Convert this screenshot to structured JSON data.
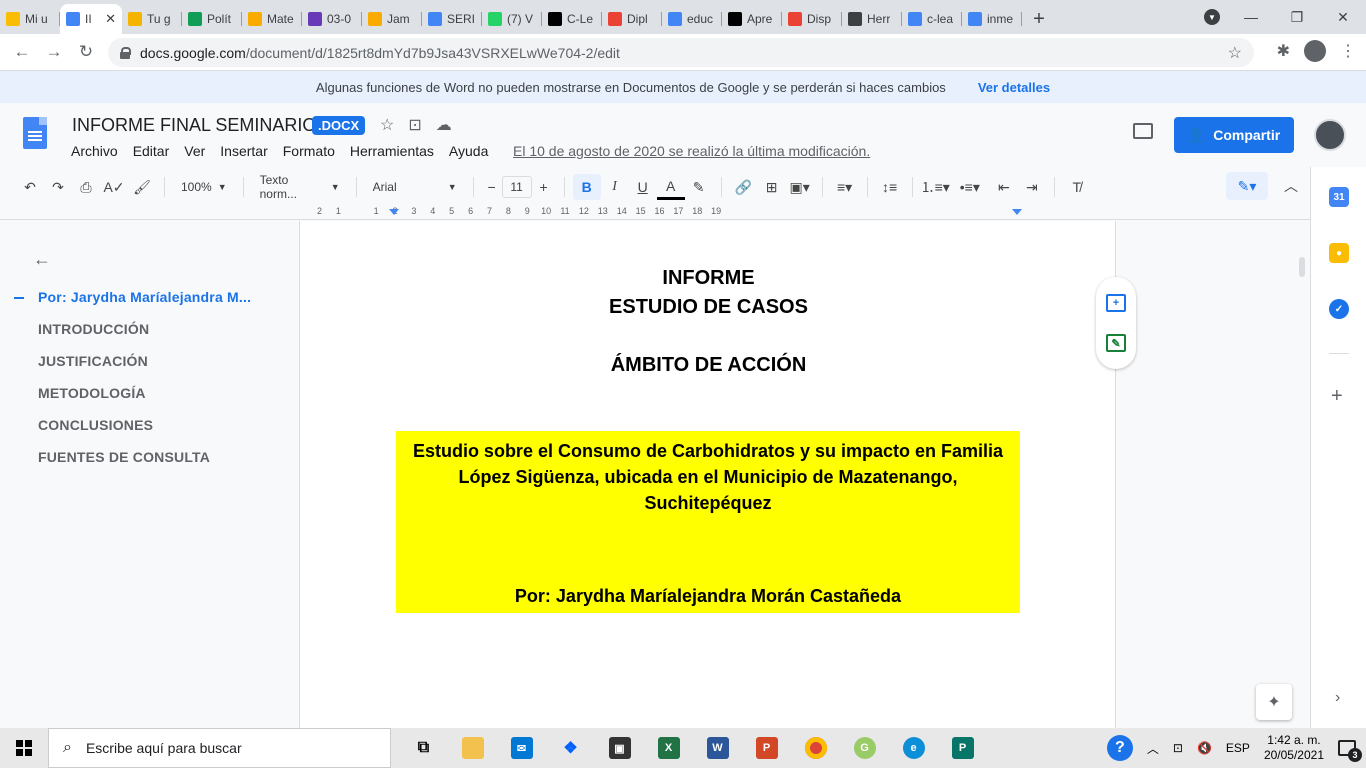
{
  "browser": {
    "tabs": [
      {
        "label": "Mi u",
        "icon": "google-drive-icon",
        "color": "#fbbc04"
      },
      {
        "label": "II",
        "icon": "google-docs-icon",
        "color": "#4285f4",
        "active": true
      },
      {
        "label": "Tu g",
        "icon": "google-slides-icon",
        "color": "#f4b400"
      },
      {
        "label": "Polít",
        "icon": "google-sheets-icon",
        "color": "#0f9d58"
      },
      {
        "label": "Mate",
        "icon": "hand-icon",
        "color": "#f9ab00"
      },
      {
        "label": "03-0",
        "icon": "forms-icon",
        "color": "#673ab7"
      },
      {
        "label": "Jam",
        "icon": "hand-icon",
        "color": "#f9ab00"
      },
      {
        "label": "SERI",
        "icon": "google-docs-icon",
        "color": "#4285f4"
      },
      {
        "label": "(7) V",
        "icon": "whatsapp-icon",
        "color": "#25d366"
      },
      {
        "label": "C-Le",
        "icon": "wix-icon",
        "color": "#000000"
      },
      {
        "label": "Dipl",
        "icon": "gmail-icon",
        "color": "#ea4335"
      },
      {
        "label": "educ",
        "icon": "google-icon",
        "color": "#4285f4"
      },
      {
        "label": "Apre",
        "icon": "wikipedia-icon",
        "color": "#000000"
      },
      {
        "label": "Disp",
        "icon": "colorful-square-icon",
        "color": "#ea4335"
      },
      {
        "label": "Herr",
        "icon": "globe-icon",
        "color": "#3c4043"
      },
      {
        "label": "c-lea",
        "icon": "google-icon",
        "color": "#4285f4"
      },
      {
        "label": "inme",
        "icon": "google-icon",
        "color": "#4285f4"
      }
    ],
    "new_tab": "+",
    "url_domain": "docs.google.com",
    "url_path": "/document/d/1825rt8dmYd7b9Jsa43VSRXELwWe704-2/edit"
  },
  "banner": {
    "message": "Algunas funciones de Word no pueden mostrarse en Documentos de Google y se perderán si haces cambios",
    "link": "Ver detalles"
  },
  "docs": {
    "title": "INFORME FINAL SEMINARIO",
    "badge": ".DOCX",
    "menu": [
      "Archivo",
      "Editar",
      "Ver",
      "Insertar",
      "Formato",
      "Herramientas",
      "Ayuda"
    ],
    "last_edit": "El 10 de agosto de 2020 se realizó la última modificación.",
    "share_label": "Compartir"
  },
  "toolbar": {
    "zoom": "100%",
    "style": "Texto norm...",
    "font": "Arial",
    "font_size": "11"
  },
  "ruler": {
    "marks": [
      "2",
      "1",
      "",
      "1",
      "2",
      "3",
      "4",
      "5",
      "6",
      "7",
      "8",
      "9",
      "10",
      "11",
      "12",
      "13",
      "14",
      "15",
      "16",
      "17",
      "18",
      "19"
    ]
  },
  "outline": {
    "items": [
      {
        "label": "Por: Jarydha Maríalejandra M...",
        "current": true
      },
      {
        "label": "INTRODUCCIÓN"
      },
      {
        "label": "JUSTIFICACIÓN"
      },
      {
        "label": "METODOLOGÍA"
      },
      {
        "label": "CONCLUSIONES"
      },
      {
        "label": "FUENTES DE CONSULTA"
      }
    ]
  },
  "document": {
    "line1": "INFORME",
    "line2": "ESTUDIO DE CASOS",
    "line3": "ÁMBITO DE ACCIÓN",
    "study_title": "Estudio sobre el Consumo de Carbohidratos y su impacto en Familia López Sigüenza, ubicada en el Municipio de Mazatenango, Suchitepéquez",
    "author": "Por: Jarydha Maríalejandra Morán Castañeda",
    "highlight_color": "#ffff00"
  },
  "side_panel": {
    "calendar_day": "31",
    "colors": {
      "calendar": "#4285f4",
      "keep": "#fbbc04",
      "tasks": "#1a73e8"
    }
  },
  "taskbar": {
    "search_placeholder": "Escribe aquí para buscar",
    "language": "ESP",
    "time": "1:42 a. m.",
    "date": "20/05/2021",
    "notifications": "3"
  }
}
